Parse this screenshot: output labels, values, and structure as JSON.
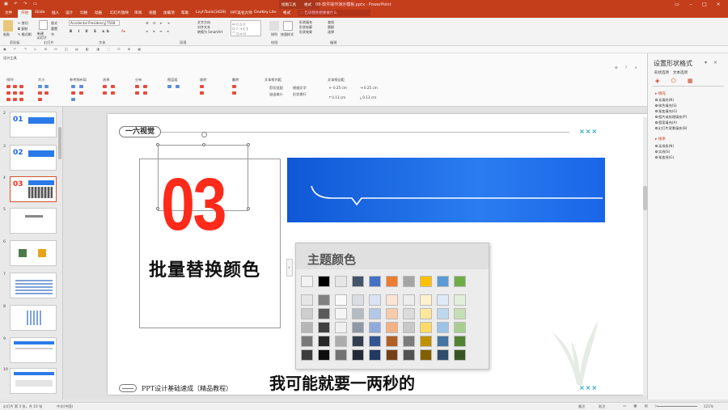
{
  "titlebar": {
    "document_title": "08-软件操作演示模板.pptx - PowerPoint",
    "context_tab_1": "绘图工具",
    "context_tab_2": "格式",
    "user": "OneKey Lite",
    "quick_access": "▣ ↶ ↷ ▭"
  },
  "tabs": [
    {
      "label": "文件"
    },
    {
      "label": "开始"
    },
    {
      "label": "iSlide"
    },
    {
      "label": "插入"
    },
    {
      "label": "设计"
    },
    {
      "label": "切换"
    },
    {
      "label": "动画"
    },
    {
      "label": "幻灯片放映"
    },
    {
      "label": "审阅"
    },
    {
      "label": "视图"
    },
    {
      "label": "加载项"
    },
    {
      "label": "帮助"
    },
    {
      "label": "LvyhTools(3429)"
    },
    {
      "label": "PPT美化大师"
    },
    {
      "label": "OneKey Lite"
    },
    {
      "label": "格式"
    }
  ],
  "search": {
    "placeholder": "告诉我你想要做什么"
  },
  "ribbon": {
    "paste": "粘贴",
    "clipboard_group": "剪贴板",
    "new_slide": "新建\n幻灯片",
    "slides_group": "幻灯片",
    "font_name": "Accidental Presidency",
    "font_size": "7508",
    "font_group": "字体",
    "paragraph_group": "段落",
    "drawing_group": "绘图",
    "editing_group": "编辑",
    "text_direction": "文字方向",
    "align_text": "对齐文本",
    "smartart": "转换为 SmartArt",
    "arrange": "排列",
    "quick_styles": "快速样式",
    "shape_fill": "形状填充",
    "shape_outline": "形状轮廓",
    "shape_effects": "形状效果",
    "find": "查找",
    "replace": "替换",
    "select": "选择",
    "layout": "版式",
    "reset": "重置",
    "section": "节"
  },
  "design_tools": {
    "title": "设计工具",
    "groups": [
      "排列",
      "大小",
      "参考线布局",
      "选择",
      "分布",
      "图层组",
      "旋转",
      "翻转",
      "文本框内距",
      "文本框边距"
    ],
    "autofit_1": "剪切适配",
    "autofit_2": "溢出缩小",
    "wrap_1": "根据文字",
    "wrap_2": "形状换行",
    "margin_left": "0.25 cm",
    "margin_right": "0.25 cm",
    "margin_top": "0.13 cm",
    "margin_bottom": "0.13 cm"
  },
  "thumbnails": [
    {
      "num": "2",
      "label": "01"
    },
    {
      "num": "3",
      "label": "02"
    },
    {
      "num": "4",
      "label": "03"
    },
    {
      "num": "5",
      "label": ""
    },
    {
      "num": "6",
      "label": ""
    },
    {
      "num": "7",
      "label": ""
    },
    {
      "num": "8",
      "label": ""
    },
    {
      "num": "9",
      "label": ""
    },
    {
      "num": "10",
      "label": ""
    }
  ],
  "slide": {
    "tag": "一六视觉",
    "big_number": "03",
    "heading": "批量替换颜色",
    "footer_label": "PPT设计基础速成（精品教程）",
    "corner_mark": "×××",
    "corner_mark_bottom": "×××"
  },
  "color_picker": {
    "title": "主题颜色",
    "theme_colors": [
      "#f2f2f2",
      "#000000",
      "#e7e6e6",
      "#44546a",
      "#4472c4",
      "#ed7d31",
      "#a5a5a5",
      "#ffc000",
      "#5b9bd5",
      "#70ad47"
    ]
  },
  "subtitle_caption": "我可能就要一两秒的",
  "taskpane": {
    "title": "设置形状格式",
    "tab_shape": "形状选项",
    "tab_text": "文本选项",
    "fill_header": "填充",
    "fill_options": [
      "无填充(N)",
      "纯色填充(S)",
      "渐变填充(G)",
      "图片或纹理填充(P)",
      "图案填充(A)",
      "幻灯片背景填充(B)"
    ],
    "line_header": "线条",
    "line_options": [
      "无线条(N)",
      "实线(S)",
      "渐变线(G)"
    ]
  },
  "statusbar": {
    "slide_info": "幻灯片 第 3 张，共 10 张",
    "language": "中文(中国)",
    "notes": "备注",
    "comments": "批注",
    "zoom": "121%"
  },
  "colors": {
    "accent": "#c43e1c",
    "number_red": "#ff2a1a",
    "banner_blue": "#1e64e6"
  }
}
